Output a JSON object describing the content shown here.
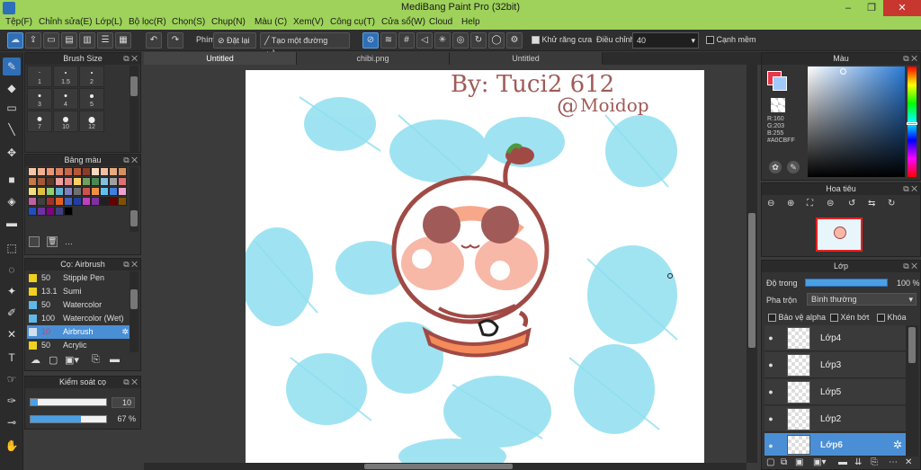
{
  "window": {
    "title": "MediBang Paint Pro (32bit)",
    "minimize": "–",
    "maximize": "❐",
    "close": "✕"
  },
  "menu": [
    "Tệp(F)",
    "Chỉnh sửa(E)",
    "Lớp(L)",
    "Bộ lọc(R)",
    "Chọn(S)",
    "Chụp(N)",
    "Màu (C)",
    "Xem(V)",
    "Công cụ(T)",
    "Cửa sổ(W)",
    "Cloud",
    "Help"
  ],
  "toolbar": {
    "undo": "↶",
    "redo": "↷",
    "phim_label": "Phím",
    "reset_label": "Đặt lại",
    "make_line_label": "Tạo một đường thẳng",
    "antialias_label": "Khử răng cưa",
    "adjust_label": "Điều chỉnh",
    "adjust_value": "40",
    "smooth_label": "Cạnh mềm"
  },
  "tabs": [
    "Untitled",
    "chibi.png",
    "Untitled"
  ],
  "brush_size": {
    "title": "Brush Size",
    "cells": [
      "1",
      "1.5",
      "2",
      "3",
      "4",
      "5",
      "7",
      "10",
      "12"
    ]
  },
  "palette": {
    "title": "Bảng màu",
    "colors": [
      "#f4c7a8",
      "#f0b090",
      "#e89878",
      "#d88060",
      "#c86848",
      "#b85838",
      "#8c3c28",
      "#f8d8c0",
      "#f0c0a0",
      "#e8a880",
      "#d89060",
      "#c87848",
      "#a05a38",
      "#603828",
      "#f0a0a0",
      "#e88888",
      "#ffd060",
      "#70a060",
      "#4a8a50",
      "#80c0e0",
      "#a0a0a0",
      "#e07070",
      "#f0e080",
      "#e0c040",
      "#90d070",
      "#60b0d0",
      "#8080c0",
      "#707070",
      "#d05050",
      "#f09040",
      "#60c0f0",
      "#4080e0",
      "#f0a0d0",
      "#c060a0",
      "#404040",
      "#a03030",
      "#e06020",
      "#4060c0",
      "#2040a0",
      "#c040c0",
      "#8030a0",
      "#202020",
      "#600000",
      "#805000",
      "#2050c0",
      "#7030a0",
      "#800080",
      "#404080",
      "#000000"
    ],
    "more": "…"
  },
  "brushes": {
    "title": "Cọ: Airbrush",
    "items": [
      {
        "size": "50",
        "name": "Stipple Pen",
        "color": "#f0d020"
      },
      {
        "size": "13.1",
        "name": "Sumi",
        "color": "#f0d020"
      },
      {
        "size": "50",
        "name": "Watercolor",
        "color": "#60b8e8"
      },
      {
        "size": "100",
        "name": "Watercolor (Wet)",
        "color": "#60b8e8"
      },
      {
        "size": "10",
        "name": "Airbrush",
        "color": "#cfe0f0"
      },
      {
        "size": "50",
        "name": "Acrylic",
        "color": "#f0d020"
      }
    ]
  },
  "brush_control": {
    "title": "Kiểm soát cọ",
    "size": "10",
    "opacity": "67 %",
    "size_fraction": 0.1,
    "opacity_fraction": 0.67
  },
  "color": {
    "title": "Màu",
    "rgb": [
      "R:160",
      "G:203",
      "B:255"
    ],
    "hex": "#A0CBFF",
    "fg": "#e8374a",
    "bg": "#a0cbff"
  },
  "navigator": {
    "title": "Hoa tiêu"
  },
  "layers": {
    "title": "Lớp",
    "opacity_label": "Độ trong",
    "opacity_value": "100 %",
    "blend_label": "Pha trộn",
    "blend_value": "Bình thường",
    "protect_alpha": "Bảo vệ alpha",
    "clipping": "Xén bớt",
    "lock": "Khóa",
    "items": [
      "Lớp4",
      "Lớp3",
      "Lớp5",
      "Lớp2",
      "Lớp6"
    ],
    "selected": "Lớp6"
  },
  "canvas_text": {
    "line1": "By: Tuci2 612",
    "line2": "@",
    "line3": "Moidop"
  },
  "accents": {
    "brand_green": "#9ed25a",
    "select_blue": "#4a8fd6",
    "splash": "#8fdff0",
    "chibi_outline": "#a04a45"
  }
}
